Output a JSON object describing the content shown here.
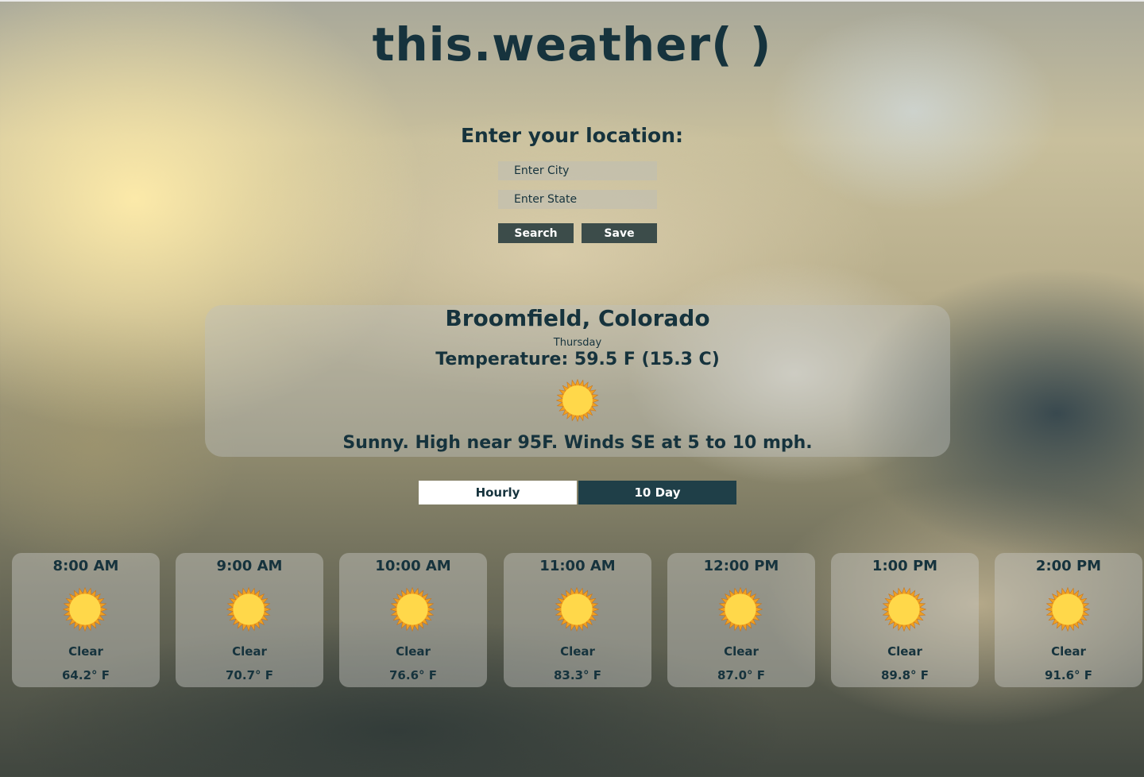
{
  "app": {
    "title": "this.weather( )"
  },
  "search": {
    "prompt": "Enter your location:",
    "city_placeholder": "Enter City",
    "state_placeholder": "Enter State",
    "search_label": "Search",
    "save_label": "Save"
  },
  "current": {
    "location": "Broomfield, Colorado",
    "day": "Thursday",
    "temperature": "Temperature: 59.5 F (15.3 C)",
    "icon": "sun-icon",
    "description": "Sunny. High near 95F. Winds SE at 5 to 10 mph."
  },
  "tabs": [
    {
      "label": "Hourly",
      "active": true
    },
    {
      "label": "10 Day",
      "active": false
    }
  ],
  "hourly": [
    {
      "time": "8:00 AM",
      "condition": "Clear",
      "temp": "64.2° F",
      "icon": "sun-icon"
    },
    {
      "time": "9:00 AM",
      "condition": "Clear",
      "temp": "70.7° F",
      "icon": "sun-icon"
    },
    {
      "time": "10:00 AM",
      "condition": "Clear",
      "temp": "76.6° F",
      "icon": "sun-icon"
    },
    {
      "time": "11:00 AM",
      "condition": "Clear",
      "temp": "83.3° F",
      "icon": "sun-icon"
    },
    {
      "time": "12:00 PM",
      "condition": "Clear",
      "temp": "87.0° F",
      "icon": "sun-icon"
    },
    {
      "time": "1:00 PM",
      "condition": "Clear",
      "temp": "89.8° F",
      "icon": "sun-icon"
    },
    {
      "time": "2:00 PM",
      "condition": "Clear",
      "temp": "91.6° F",
      "icon": "sun-icon"
    }
  ],
  "colors": {
    "text": "#16333d",
    "button_bg": "#3c4c4a",
    "tab_active_bg": "#ffffff",
    "tab_inactive_bg": "#1f3f48",
    "sun_core": "#ffd84a",
    "sun_rays": "#f0a020"
  }
}
